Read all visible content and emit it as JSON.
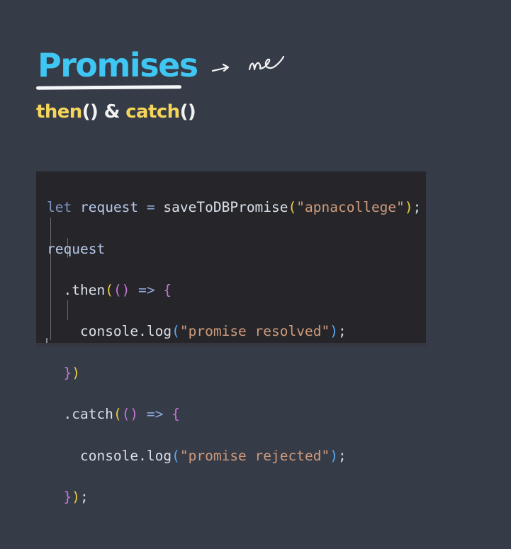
{
  "slide": {
    "title": "Promises",
    "annotation": "→ ✓",
    "subtitle": {
      "then_word": "then",
      "then_parens": "()",
      "amp": "&",
      "catch_word": "catch",
      "catch_parens": "()"
    }
  },
  "code": {
    "line1": {
      "kw": "let",
      "var": "request",
      "eq": "=",
      "fn": "saveToDBPromise",
      "open": "(",
      "str": "\"apnacollege\"",
      "close": ")",
      "semi": ";"
    },
    "line2": {
      "var": "request"
    },
    "line3": {
      "dot_then": ".then",
      "open": "(",
      "args": "()",
      "arrow": "=>",
      "brace": "{"
    },
    "line4": {
      "obj": "console",
      "dot_log": ".log",
      "open": "(",
      "str": "\"promise resolved\"",
      "close": ")",
      "semi": ";"
    },
    "line5": {
      "brace": "}",
      "close": ")"
    },
    "line6": {
      "dot_catch": ".catch",
      "open": "(",
      "args": "()",
      "arrow": "=>",
      "brace": "{"
    },
    "line7": {
      "obj": "console",
      "dot_log": ".log",
      "open": "(",
      "str": "\"promise rejected\"",
      "close": ")",
      "semi": ";"
    },
    "line8": {
      "brace": "}",
      "close": ")",
      "semi": ";"
    }
  }
}
